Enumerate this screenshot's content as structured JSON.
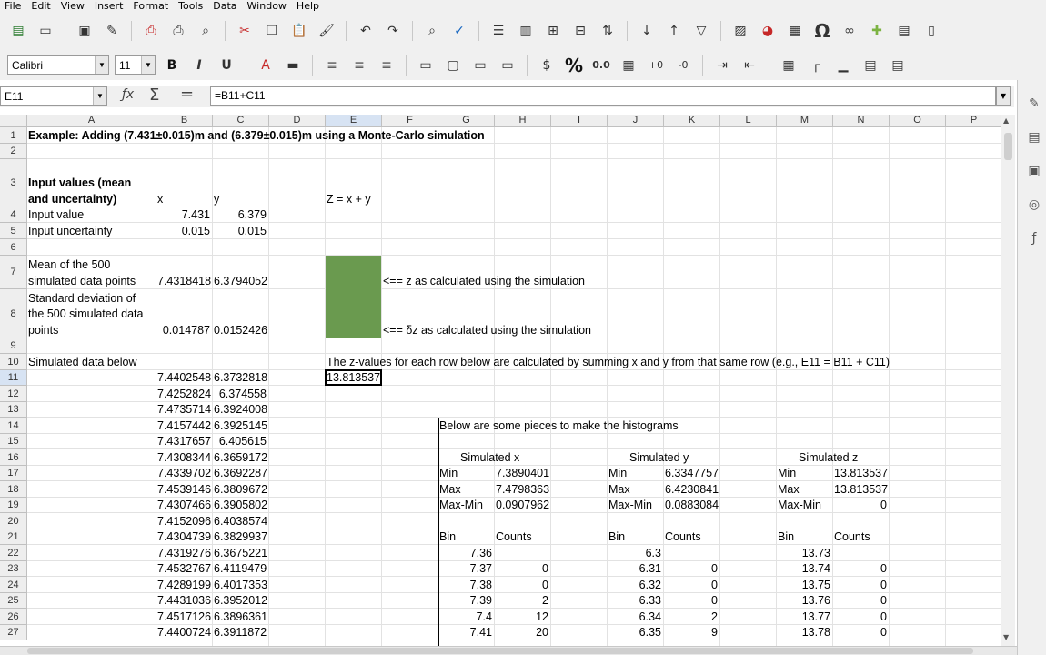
{
  "menu": [
    "File",
    "Edit",
    "View",
    "Insert",
    "Format",
    "Tools",
    "Data",
    "Window",
    "Help"
  ],
  "toolbar1_icons": [
    "new-icon",
    "open-icon",
    "save-icon",
    "edit-file-icon",
    "export-pdf-icon",
    "print-icon",
    "print-preview-icon",
    "cut-icon",
    "copy-icon",
    "paste-icon",
    "clone-formatting-icon",
    "undo-icon",
    "redo-icon",
    "find-replace-icon",
    "spelling-icon",
    "row-icon",
    "column-icon",
    "insert-row-icon",
    "delete-row-icon",
    "sort-icon",
    "sort-ascending-icon",
    "sort-descending-icon",
    "autofilter-icon",
    "image-icon",
    "chart-icon",
    "pivot-table-icon",
    "special-character-icon",
    "hyperlink-icon",
    "comment-icon",
    "headers-footers-icon",
    "define-print-area-icon"
  ],
  "font": {
    "name": "Calibri",
    "size": "11"
  },
  "toolbar2_icons": [
    "bold-icon",
    "italic-icon",
    "underline-icon",
    "font-color-icon",
    "highlight-icon",
    "align-left-icon",
    "align-center-icon",
    "align-right-icon",
    "merge-cells-icon",
    "wrap-icon",
    "align-top-icon",
    "align-bottom-icon",
    "currency-icon",
    "percent-icon",
    "number-icon",
    "date-icon",
    "add-decimal-icon",
    "delete-decimal-icon",
    "increase-indent-icon",
    "decrease-indent-icon",
    "borders-icon",
    "border-style-icon",
    "border-color-icon",
    "conditional-icon",
    "styles-icon"
  ],
  "formula": {
    "cell_ref": "E11",
    "text": "=B11+C11"
  },
  "columns": [
    "A",
    "B",
    "C",
    "D",
    "E",
    "F",
    "G",
    "H",
    "I",
    "J",
    "K",
    "L",
    "M",
    "N",
    "O",
    "P"
  ],
  "selected_column": "E",
  "rows": [
    "1",
    "2",
    "3",
    "4",
    "5",
    "6",
    "7",
    "8",
    "9",
    "10",
    "11",
    "12",
    "13",
    "14",
    "15",
    "16",
    "17",
    "18",
    "19",
    "20",
    "21",
    "22",
    "23",
    "24",
    "25",
    "26",
    "27"
  ],
  "selected_row": "11",
  "cells": {
    "a1": "Example: Adding (7.431±0.015)m and (6.379±0.015)m using a Monte-Carlo simulation",
    "a3": "Input values (mean and uncertainty)",
    "b3": "x",
    "c3": "y",
    "e3": "Z = x + y",
    "a4": "Input value",
    "b4": "7.431",
    "c4": "6.379",
    "a5": "Input uncertainty",
    "b5": "0.015",
    "c5": "0.015",
    "a7": "Mean of the 500 simulated data points",
    "b7": "7.4318418",
    "c7": "6.3794052",
    "f7": "<== z as calculated using the simulation",
    "a8": "Standard deviation of the 500 simulated data points",
    "b8": "0.014787",
    "c8": "0.0152426",
    "f8": "<== δz as calculated using the simulation",
    "a10": "Simulated data below",
    "e10": "The z-values for each row below are calculated by summing x and y from that same row (e.g., E11 = B11 + C11)",
    "e11": "13.813537"
  },
  "sim_rows": [
    [
      "7.4402548",
      "6.3732818"
    ],
    [
      "7.4252824",
      "6.374558"
    ],
    [
      "7.4735714",
      "6.3924008"
    ],
    [
      "7.4157442",
      "6.3925145"
    ],
    [
      "7.4317657",
      "6.405615"
    ],
    [
      "7.4308344",
      "6.3659172"
    ],
    [
      "7.4339702",
      "6.3692287"
    ],
    [
      "7.4539146",
      "6.3809672"
    ],
    [
      "7.4307466",
      "6.3905802"
    ],
    [
      "7.4152096",
      "6.4038574"
    ],
    [
      "7.4304739",
      "6.3829937"
    ],
    [
      "7.4319276",
      "6.3675221"
    ],
    [
      "7.4532767",
      "6.4119479"
    ],
    [
      "7.4289199",
      "6.4017353"
    ],
    [
      "7.4431036",
      "6.3952012"
    ],
    [
      "7.4517126",
      "6.3896361"
    ],
    [
      "7.4400724",
      "6.3911872"
    ]
  ],
  "histo": {
    "title": "Below are some pieces to make the histograms",
    "x": {
      "header": "Simulated x",
      "min_label": "Min",
      "min": "7.3890401",
      "max_label": "Max",
      "max": "7.4798363",
      "range_label": "Max-Min",
      "range": "0.0907962",
      "bin_label": "Bin",
      "counts_label": "Counts",
      "bins": [
        [
          "7.36",
          ""
        ],
        [
          "7.37",
          "0"
        ],
        [
          "7.38",
          "0"
        ],
        [
          "7.39",
          "2"
        ],
        [
          "7.4",
          "12"
        ],
        [
          "7.41",
          "20"
        ]
      ]
    },
    "y": {
      "header": "Simulated y",
      "min_label": "Min",
      "min": "6.3347757",
      "max_label": "Max",
      "max": "6.4230841",
      "range_label": "Max-Min",
      "range": "0.0883084",
      "bin_label": "Bin",
      "counts_label": "Counts",
      "bins": [
        [
          "6.3",
          ""
        ],
        [
          "6.31",
          "0"
        ],
        [
          "6.32",
          "0"
        ],
        [
          "6.33",
          "0"
        ],
        [
          "6.34",
          "2"
        ],
        [
          "6.35",
          "9"
        ]
      ]
    },
    "z": {
      "header": "Simulated z",
      "min_label": "Min",
      "min": "13.813537",
      "max_label": "Max",
      "max": "13.813537",
      "range_label": "Max-Min",
      "range": "0",
      "bin_label": "Bin",
      "counts_label": "Counts",
      "bins": [
        [
          "13.73",
          ""
        ],
        [
          "13.74",
          "0"
        ],
        [
          "13.75",
          "0"
        ],
        [
          "13.76",
          "0"
        ],
        [
          "13.77",
          "0"
        ],
        [
          "13.78",
          "0"
        ]
      ]
    }
  },
  "sidebar_icons": [
    "properties-icon",
    "styles-icon",
    "gallery-icon",
    "navigator-icon",
    "functions-icon"
  ]
}
